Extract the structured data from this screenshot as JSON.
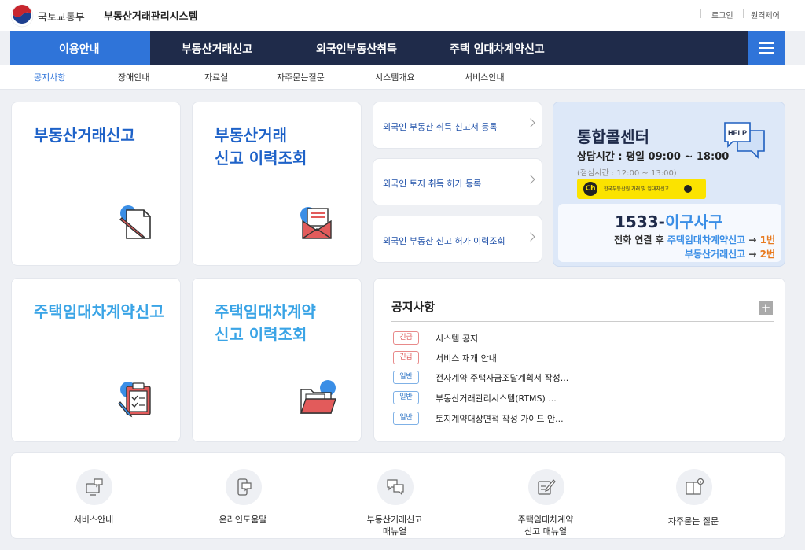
{
  "header": {
    "ministry": "국토교통부",
    "system_name": "부동산거래관리시스템",
    "login": "로그인",
    "remote_support": "원격제어"
  },
  "nav": {
    "items": [
      "이용안내",
      "부동산거래신고",
      "외국인부동산취득",
      "주택 임대차계약신고"
    ],
    "active": "이용안내",
    "accent_color": "#2f74d9",
    "bar_color": "#1f2b4a"
  },
  "subnav": {
    "items": [
      "공지사항",
      "장애안내",
      "자료실",
      "자주묻는질문",
      "시스템개요",
      "서비스안내"
    ],
    "active": "공지사항"
  },
  "cards": {
    "real_estate_report": {
      "title": "부동산거래신고",
      "icon": "pen-document-icon"
    },
    "real_estate_history": {
      "title_line1": "부동산거래",
      "title_line2": "신고 이력조회",
      "icon": "mail-icon"
    },
    "rental_report": {
      "title": "주택임대차계약신고",
      "icon": "clipboard-icon"
    },
    "rental_history": {
      "title_line1": "주택임대차계약",
      "title_line2": "신고 이력조회",
      "icon": "folder-icon"
    }
  },
  "foreign_links": [
    "외국인 부동산 취득 신고서 등록",
    "외국인 토지 취득 허가 등록",
    "외국인 부동산 신고 허가 이력조회"
  ],
  "callcenter": {
    "title": "통합콜센터",
    "hours": "상담시간 : 평일 09:00 ~ 18:00",
    "lunch": "(점심시간 : 12:00 ~ 13:00)",
    "kakao_text": "한국부동산원 거래 및 임대차신고",
    "kakao_ch": "Ch",
    "help_label": "HELP",
    "phone_number": "1533-",
    "phone_word": "이구사구",
    "line1_prefix": "전화 연결 후 ",
    "line1_target": "주택임대차계약신고",
    "line1_arrow": " → ",
    "line1_num": "1번",
    "line2_target": "부동산거래신고",
    "line2_arrow": " → ",
    "line2_num": "2번"
  },
  "notice": {
    "title": "공지사항",
    "more": "+",
    "rows": [
      {
        "badge": "긴급",
        "text": "시스템 공지"
      },
      {
        "badge": "긴급",
        "text": "서비스 재개 안내"
      },
      {
        "badge": "일반",
        "text": "전자계약 주택자금조달계획서 작성..."
      },
      {
        "badge": "일반",
        "text": "부동산거래관리시스템(RTMS) ..."
      },
      {
        "badge": "일반",
        "text": "토지계약대상면적 작성 가이드 안..."
      }
    ]
  },
  "quick_menu": [
    {
      "label": "서비스안내",
      "icon": "monitor-chat-icon"
    },
    {
      "label": "온라인도움말",
      "icon": "phone-chat-icon"
    },
    {
      "label_line1": "부동산거래신고",
      "label_line2": "매뉴얼",
      "icon": "speech-bubbles-icon"
    },
    {
      "label_line1": "주택임대차계약",
      "label_line2": "신고 매뉴얼",
      "icon": "pen-note-icon"
    },
    {
      "label": "자주묻는 질문",
      "icon": "book-info-icon"
    }
  ]
}
